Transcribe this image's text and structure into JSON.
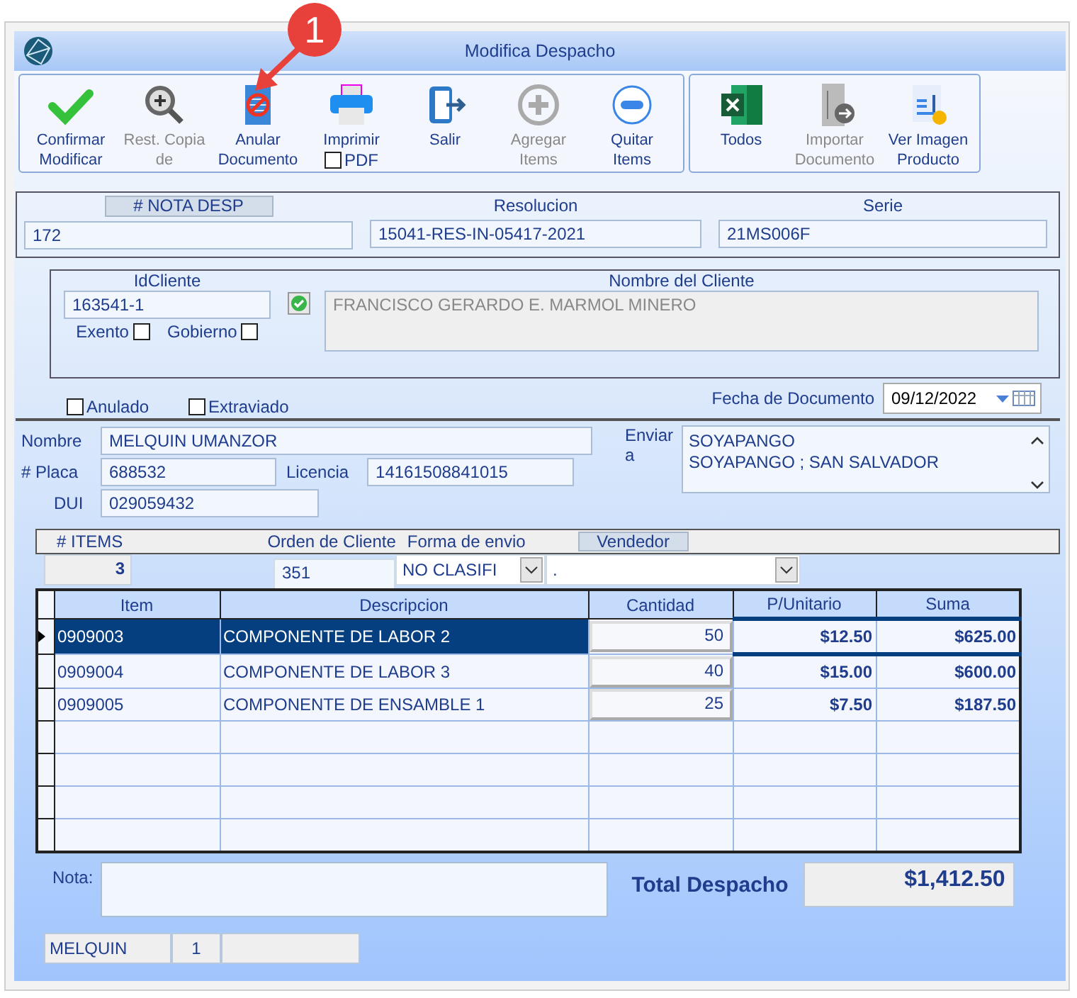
{
  "window": {
    "title": "Modifica Despacho"
  },
  "callout": {
    "label": "1"
  },
  "toolbar": {
    "groups": [
      [
        {
          "kind": "check",
          "label": "Confirmar\nModificar",
          "disabled": false
        },
        {
          "kind": "zoom",
          "label": "Rest. Copia\nde",
          "disabled": true
        },
        {
          "kind": "void",
          "label": "Anular\nDocumento",
          "disabled": false
        },
        {
          "kind": "printer",
          "label": "Imprimir",
          "disabled": false,
          "pdf": {
            "label": "PDF",
            "checked": false
          }
        },
        {
          "kind": "exit",
          "label": "Salir",
          "disabled": false
        },
        {
          "kind": "plus",
          "label": "Agregar\nItems",
          "disabled": true
        },
        {
          "kind": "minus",
          "label": "Quitar\nItems",
          "disabled": false
        }
      ],
      [
        {
          "kind": "excel",
          "label": "Todos",
          "disabled": false
        },
        {
          "kind": "import",
          "label": "Importar\nDocumento",
          "disabled": true
        },
        {
          "kind": "invoice",
          "label": "Ver Imagen\nProducto",
          "disabled": false
        }
      ]
    ]
  },
  "header": {
    "nota": {
      "label": "# NOTA DESP",
      "value": "172"
    },
    "resolucion": {
      "label": "Resolucion",
      "value": "15041-RES-IN-05417-2021"
    },
    "serie": {
      "label": "Serie",
      "value": "21MS006F"
    }
  },
  "client": {
    "id": {
      "label": "IdCliente",
      "value": "163541-1"
    },
    "name": {
      "label": "Nombre del Cliente",
      "value": "FRANCISCO GERARDO E. MARMOL MINERO"
    },
    "flags": [
      {
        "label": "Exento",
        "checked": false
      },
      {
        "label": "Gobierno",
        "checked": false
      }
    ]
  },
  "status_flags": [
    {
      "label": "Anulado",
      "checked": false
    },
    {
      "label": "Extraviado",
      "checked": false
    }
  ],
  "fecha": {
    "label": "Fecha de Documento",
    "value": "09/12/2022"
  },
  "driver": {
    "nombre": {
      "label": "Nombre",
      "value": "MELQUIN UMANZOR"
    },
    "placa": {
      "label": "# Placa",
      "value": "688532"
    },
    "licencia": {
      "label": "Licencia",
      "value": "14161508841015"
    },
    "dui": {
      "label": "DUI",
      "value": "029059432"
    },
    "enviar": {
      "label": "Enviar a",
      "lines": [
        "SOYAPANGO",
        "SOYAPANGO ; SAN SALVADOR"
      ]
    }
  },
  "items_bar": {
    "items": {
      "label": "# ITEMS",
      "value": "3"
    },
    "orden": {
      "label": "Orden de Cliente",
      "value": "351"
    },
    "forma": {
      "label": "Forma de envio",
      "value": "NO CLASIFI"
    },
    "vendedor": {
      "label": "Vendedor",
      "value": "."
    }
  },
  "table": {
    "columns": [
      "Item",
      "Descripcion",
      "Cantidad",
      "P/Unitario",
      "Suma"
    ],
    "rows": [
      {
        "item": "0909003",
        "descripcion": "COMPONENTE DE LABOR 2",
        "cantidad": "50",
        "unitario": "$12.50",
        "suma": "$625.00",
        "selected": true
      },
      {
        "item": "0909004",
        "descripcion": "COMPONENTE DE LABOR 3",
        "cantidad": "40",
        "unitario": "$15.00",
        "suma": "$600.00",
        "selected": false
      },
      {
        "item": "0909005",
        "descripcion": "COMPONENTE DE ENSAMBLE 1",
        "cantidad": "25",
        "unitario": "$7.50",
        "suma": "$187.50",
        "selected": false
      }
    ]
  },
  "nota": {
    "label": "Nota:"
  },
  "total": {
    "label": "Total Despacho",
    "value": "$1,412.50"
  },
  "status_bar": [
    "MELQUIN",
    "1"
  ]
}
